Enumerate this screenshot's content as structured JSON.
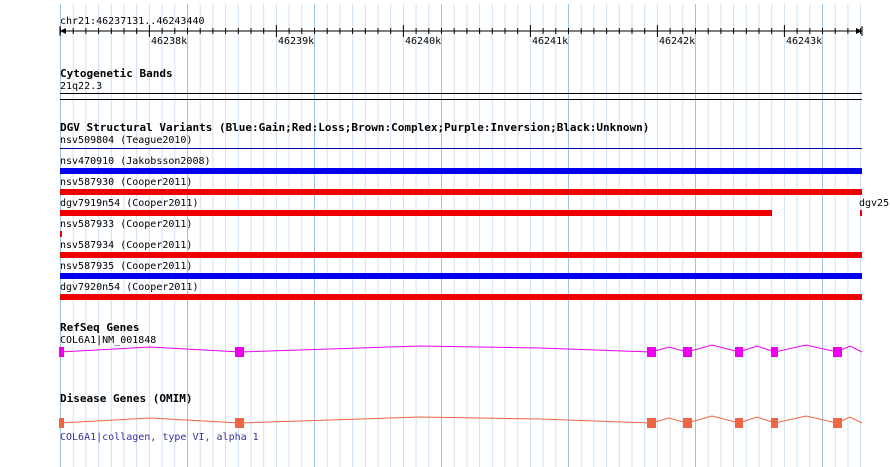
{
  "header": {
    "locus": "chr21:46237131..46243440"
  },
  "ruler": {
    "ticks": [
      "46238k",
      "46239k",
      "46240k",
      "46241k",
      "46242k",
      "46243k"
    ]
  },
  "cytoband": {
    "title": "Cytogenetic Bands",
    "band": "21q22.3"
  },
  "dgv": {
    "title": "DGV Structural Variants (Blue:Gain;Red:Loss;Brown:Complex;Purple:Inversion;Black:Unknown)",
    "variants": [
      {
        "label": "nsv509804 (Teague2010)",
        "type": "Unknown",
        "color": "#0000aa"
      },
      {
        "label": "nsv470910 (Jakobsson2008)",
        "type": "Gain",
        "color": "#0000ee"
      },
      {
        "label": "nsv587930 (Cooper2011)",
        "type": "Loss",
        "color": "#ee0000"
      },
      {
        "label": "dgv7919n54 (Cooper2011)",
        "type": "Loss",
        "color": "#ee0000"
      },
      {
        "label": "nsv587933 (Cooper2011)",
        "type": "Loss",
        "color": "#ee0000"
      },
      {
        "label": "nsv587934 (Cooper2011)",
        "type": "Loss",
        "color": "#ee0000"
      },
      {
        "label": "nsv587935 (Cooper2011)",
        "type": "Gain",
        "color": "#0000ee"
      },
      {
        "label": "dgv7920n54 (Cooper2011)",
        "type": "Loss",
        "color": "#ee0000"
      }
    ],
    "clipped_label": "dgv25"
  },
  "refseq": {
    "title": "RefSeq Genes",
    "gene": "COL6A1|NM_001848",
    "color": "#ee00ee"
  },
  "omim": {
    "title": "Disease Genes (OMIM)",
    "gene": "COL6A1|collagen, type VI, alpha 1",
    "color": "#ee6644"
  }
}
